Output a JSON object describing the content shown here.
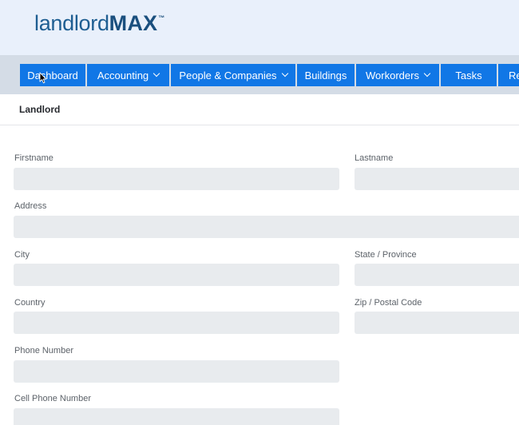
{
  "logo": {
    "light": "landlord",
    "bold": "MAX",
    "tm": "™"
  },
  "nav": {
    "items": [
      {
        "label": "Dashboard",
        "dropdown": false
      },
      {
        "label": "Accounting",
        "dropdown": true
      },
      {
        "label": "People & Companies",
        "dropdown": true
      },
      {
        "label": "Buildings",
        "dropdown": false
      },
      {
        "label": "Workorders",
        "dropdown": true
      },
      {
        "label": "Tasks",
        "dropdown": false
      },
      {
        "label": "Re",
        "dropdown": false
      }
    ]
  },
  "section": {
    "title": "Landlord"
  },
  "form": {
    "firstname": {
      "label": "Firstname",
      "value": ""
    },
    "lastname": {
      "label": "Lastname",
      "value": ""
    },
    "address": {
      "label": "Address",
      "value": ""
    },
    "city": {
      "label": "City",
      "value": ""
    },
    "state": {
      "label": "State / Province",
      "value": ""
    },
    "country": {
      "label": "Country",
      "value": ""
    },
    "zip": {
      "label": "Zip / Postal Code",
      "value": ""
    },
    "phone": {
      "label": "Phone Number",
      "value": ""
    },
    "cell": {
      "label": "Cell Phone Number",
      "value": ""
    }
  },
  "colors": {
    "accent": "#1177e6",
    "header_bg": "#e9f0fb",
    "nav_bg": "#d4dce6",
    "input_bg": "#e8ebee",
    "logo": "#1a4f7e"
  },
  "icons": [
    "chevron-down-icon",
    "mouse-cursor-icon"
  ]
}
